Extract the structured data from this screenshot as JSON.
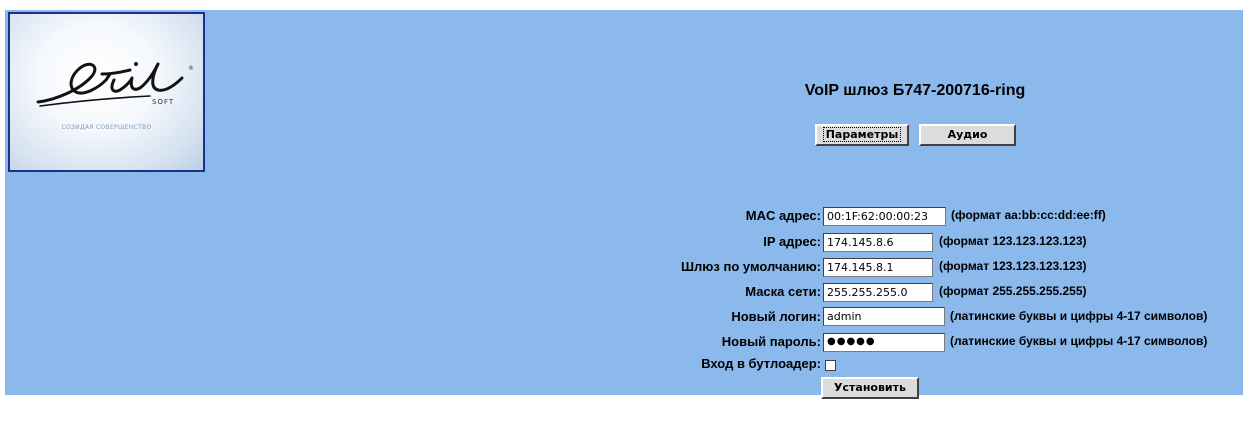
{
  "logo": {
    "brand": "Stil",
    "brand_sub": "SOFT",
    "tagline": "СОЗИДАЯ СОВЕРШЕНСТВО"
  },
  "header": {
    "title": "VoIP шлюз Б747-200716-ring"
  },
  "tabs": [
    {
      "label": "Параметры",
      "active": true
    },
    {
      "label": "Аудио",
      "active": false
    }
  ],
  "form": {
    "mac": {
      "label": "MAC адрес:",
      "value": "00:1F:62:00:00:23",
      "hint": "(формат aa:bb:cc:dd:ee:ff)"
    },
    "ip": {
      "label": "IP адрес:",
      "value": "174.145.8.6",
      "hint": "(формат 123.123.123.123)"
    },
    "gateway": {
      "label": "Шлюз по умолчанию:",
      "value": "174.145.8.1",
      "hint": "(формат 123.123.123.123)"
    },
    "mask": {
      "label": "Маска сети:",
      "value": "255.255.255.0",
      "hint": "(формат 255.255.255.255)"
    },
    "login": {
      "label": "Новый логин:",
      "value": "admin",
      "hint": "(латинские буквы и цифры 4-17 символов)"
    },
    "password": {
      "label": "Новый пароль:",
      "value": "●●●●●",
      "hint": "(латинские буквы и цифры 4-17 символов)"
    },
    "bootloader": {
      "label": "Вход в бутлоадер:",
      "checked": false
    },
    "submit_label": "Установить"
  }
}
